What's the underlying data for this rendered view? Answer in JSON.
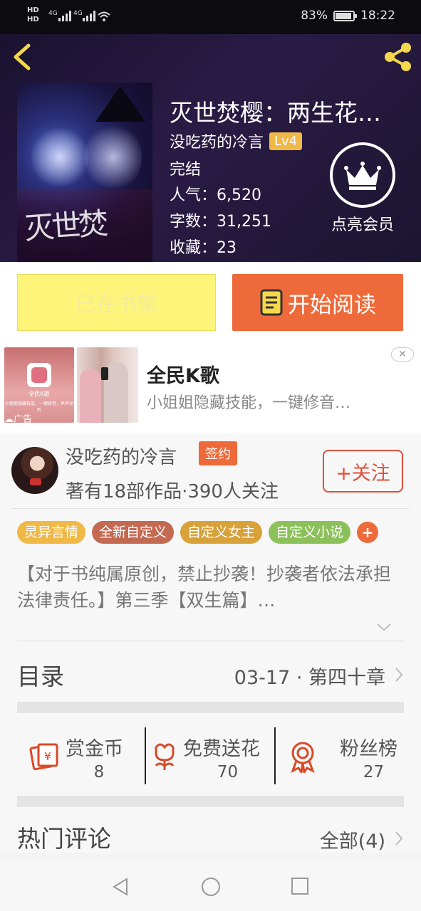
{
  "status_bar": {
    "hd1": "HD",
    "hd2": "HD",
    "signal1": "4G",
    "signal2": "4G",
    "battery_percent": "83%",
    "battery_level": 0.83,
    "time": "18:22"
  },
  "book": {
    "title": "灭世焚樱：两生花…",
    "author": "没吃药的冷言",
    "level": "Lv4",
    "status": "完结",
    "popularity": "人气：6,520",
    "word_count": "字数：31,251",
    "favorites": "收藏：23"
  },
  "vip": {
    "label": "点亮会员"
  },
  "actions": {
    "shelf_label": "已在书架",
    "read_label": "开始阅读"
  },
  "ad": {
    "title": "全民K歌",
    "description": "小姐姐隐藏技能，一键修音…",
    "tag": "广告",
    "close": "✕",
    "thumb_title": "全民K歌",
    "thumb_text": "小姐姐隐藏技能，一键修音，声声动听"
  },
  "author_card": {
    "name": "没吃药的冷言",
    "sign_badge": "签约",
    "stats": "著有18部作品·390人关注",
    "follow_label": "+关注"
  },
  "tags": [
    {
      "label": "灵异言情",
      "color": "#f0b847"
    },
    {
      "label": "全新自定义",
      "color": "#c46a52"
    },
    {
      "label": "自定义女主",
      "color": "#d8a23a"
    },
    {
      "label": "自定义小说",
      "color": "#8cc05a"
    }
  ],
  "tag_add": "+",
  "description": "【对于书纯属原创，禁止抄袭！抄袭者依法承担法律责任。】第三季【双生篇】…",
  "toc": {
    "label": "目录",
    "latest": "03-17 · 第四十章"
  },
  "stats": {
    "reward_label": "赏金币",
    "reward_value": "8",
    "flower_label": "免费送花",
    "flower_value": "70",
    "fans_label": "粉丝榜",
    "fans_value": "27"
  },
  "hot_comments": {
    "label": "热门评论",
    "all": "全部(4)"
  },
  "colors": {
    "accent": "#ee6a3a",
    "shelf": "#fef47a",
    "icon_red": "#d84a2a",
    "back_arrow": "#f5d84a"
  }
}
